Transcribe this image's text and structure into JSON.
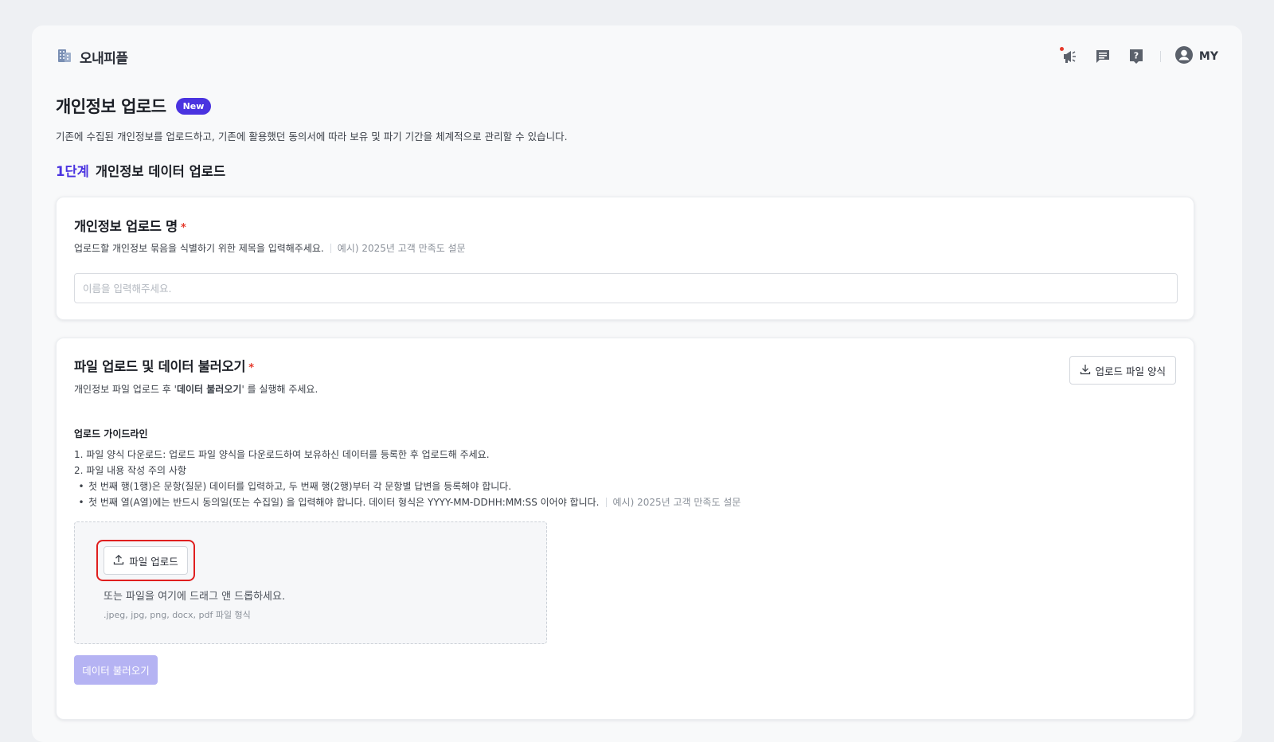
{
  "brand": {
    "name": "오내피플",
    "logo_icon": "building-icon"
  },
  "header": {
    "icons": [
      "megaphone-icon",
      "message-icon",
      "help-icon"
    ],
    "user_label": "MY"
  },
  "page": {
    "title": "개인정보 업로드",
    "badge": "New",
    "description": "기존에 수집된 개인정보를 업로드하고, 기존에 활용했던 동의서에 따라 보유 및 파기 기간을 체계적으로 관리할 수 있습니다.",
    "step_number": "1단계",
    "step_title": "개인정보 데이터 업로드"
  },
  "name_section": {
    "title": "개인정보 업로드 명",
    "required_mark": "*",
    "subtitle": "업로드할 개인정보 묶음을 식별하기 위한 제목을 입력해주세요.",
    "example": "예시) 2025년 고객 만족도 설문",
    "input_placeholder": "이름을 입력해주세요.",
    "input_value": ""
  },
  "file_section": {
    "title": "파일 업로드 및 데이터 불러오기",
    "required_mark": "*",
    "subtitle_prefix": "개인정보 파일 업로드 후 '",
    "subtitle_bold": "데이터 불러오기",
    "subtitle_suffix": "' 를 실행해 주세요.",
    "template_button": "업로드 파일 양식",
    "guide_title": "업로드 가이드라인",
    "guide_items": [
      "1. 파일 양식 다운로드: 업로드 파일 양식을 다운로드하여 보유하신 데이터를 등록한 후 업로드해 주세요.",
      "2. 파일 내용 작성 주의 사항",
      "첫 번째 행(1행)은 문항(질문) 데이터를 입력하고, 두 번째 행(2행)부터 각 문항별 답변을 등록해야 합니다.",
      "첫 번째 열(A열)에는 반드시 동의일(또는 수집일) 을 입력해야 합니다. 데이터 형식은 YYYY-MM-DDHH:MM:SS 이어야 합니다."
    ],
    "guide_bullet": "•",
    "guide_example": "예시) 2025년 고객 만족도 설문",
    "upload_button": "파일 업로드",
    "drop_hint": "또는 파일을 여기에 드래그 앤 드롭하세요.",
    "formats": ".jpeg, jpg, png, docx, pdf 파일 형식",
    "load_button": "데이터 불러오기"
  },
  "colors": {
    "accent": "#4a33e0",
    "required": "#e5392b",
    "highlight": "#e01f1f",
    "disabled_button": "#b5b3f3"
  }
}
